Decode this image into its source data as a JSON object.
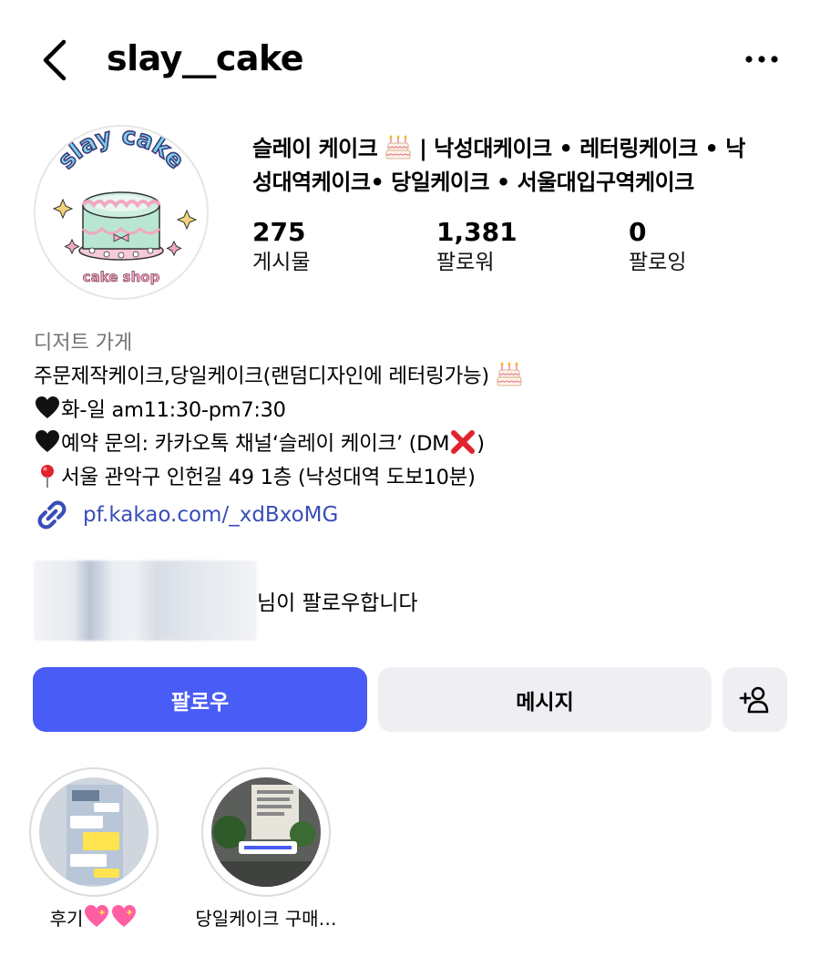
{
  "header": {
    "username": "slay__cake",
    "back_icon": "chevron-left-icon",
    "more_icon": "more-horizontal-icon"
  },
  "profile": {
    "avatar_text_top": "slay cake",
    "avatar_text_bottom": "cake shop",
    "name_line1_a": "슬레이 케이크",
    "name_line1_b": "| 낙성대케이크 • 레터링케이크 • 낙",
    "name_line2": "성대역케이크• 당일케이크 • 서울대입구역케이크"
  },
  "stats": {
    "posts": {
      "value": "275",
      "label": "게시물"
    },
    "followers": {
      "value": "1,381",
      "label": "팔로워"
    },
    "following": {
      "value": "0",
      "label": "팔로잉"
    }
  },
  "bio": {
    "category": "디저트 가게",
    "line1": "주문제작케이크,당일케이크(랜덤디자인에 레터링가능)",
    "line2": "화-일 am11:30-pm7:30",
    "line3_a": "예약 문의: 카카오톡 채널‘슬레이 케이크’ (DM",
    "line3_b": ")",
    "line4": "서울 관악구 인헌길 49 1층 (낙성대역 도보10분)",
    "link": "pf.kakao.com/_xdBxoMG"
  },
  "followed_by": {
    "suffix": "님이 팔로우합니다"
  },
  "actions": {
    "follow": "팔로우",
    "message": "메시지",
    "add_icon": "add-person-icon"
  },
  "highlights": [
    {
      "label": "후기"
    },
    {
      "label": "당일케이크 구매…"
    }
  ],
  "colors": {
    "accent": "#4a5cf6",
    "link": "#3a4db8",
    "secondary_button": "#efeff3",
    "muted_text": "#737373"
  }
}
